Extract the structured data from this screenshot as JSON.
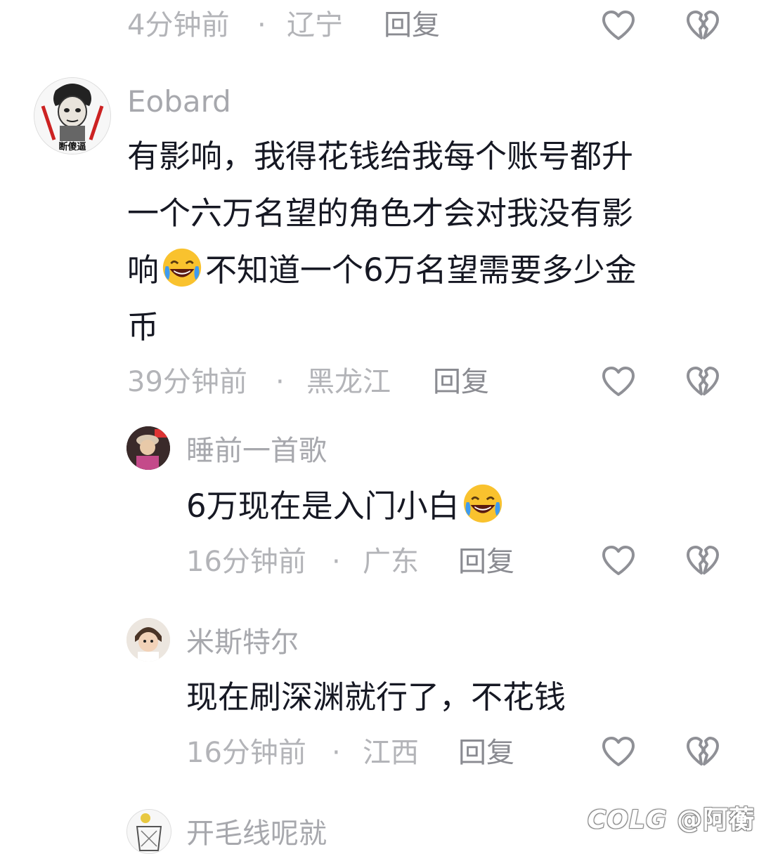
{
  "comments": [
    {
      "time": "4分钟前",
      "location": "辽宁",
      "reply_label": "回复"
    },
    {
      "username": "Eobard",
      "avatar_text": "断傻逼",
      "text_line1": "有影响，我得花钱给我每个账号都升",
      "text_line2": "一个六万名望的角色才会对我没有影",
      "text_line3_a": "响",
      "text_line3_b": "不知道一个6万名望需要多少金",
      "text_line4": "币",
      "emoji": "😂",
      "time": "39分钟前",
      "location": "黑龙江",
      "reply_label": "回复",
      "replies": [
        {
          "username": "睡前一首歌",
          "text": "6万现在是入门小白",
          "emoji": "😂",
          "time": "16分钟前",
          "location": "广东",
          "reply_label": "回复"
        },
        {
          "username": "米斯特尔",
          "text": "现在刷深渊就行了，不花钱",
          "time": "16分钟前",
          "location": "江西",
          "reply_label": "回复"
        },
        {
          "username": "开毛线呢就"
        }
      ]
    }
  ],
  "separator": "·",
  "icons": {
    "like": "heart-outline-icon",
    "dislike": "broken-heart-icon"
  },
  "colors": {
    "text": "#161823",
    "meta": "#b3b4b8",
    "reply": "#8a8b91",
    "icon": "#8f9096"
  },
  "watermark": {
    "logo": "COLG",
    "handle": "@阿蘅"
  }
}
